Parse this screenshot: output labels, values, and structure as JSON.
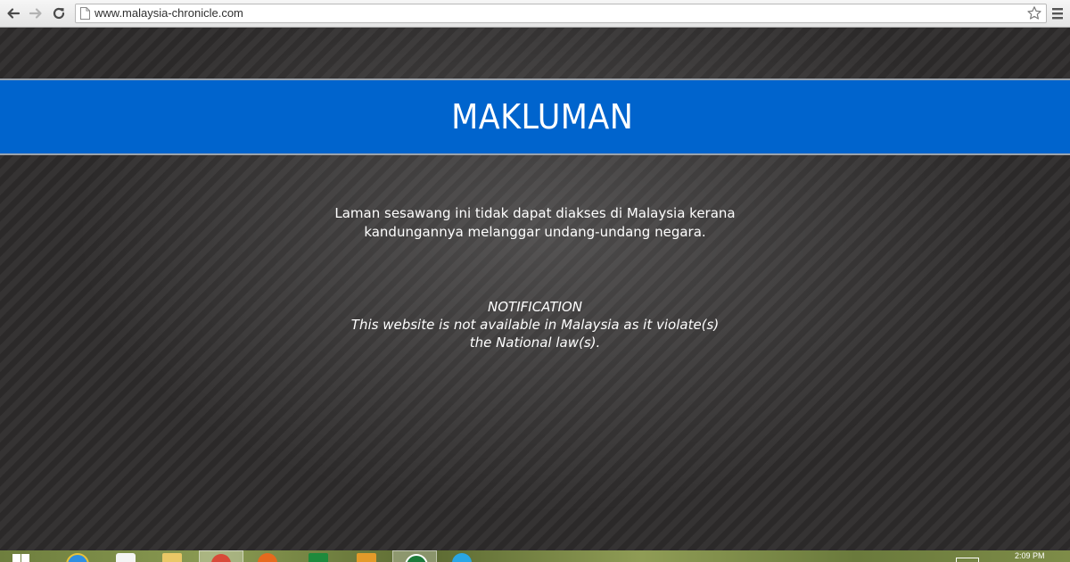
{
  "browser": {
    "url": "www.malaysia-chronicle.com",
    "icons": {
      "back": "back-arrow-icon",
      "forward": "forward-arrow-icon",
      "reload": "reload-icon",
      "page": "page-icon",
      "bookmark": "star-icon",
      "menu": "hamburger-menu-icon"
    }
  },
  "notice": {
    "title": "MAKLUMAN",
    "malay_line1": "Laman sesawang ini tidak dapat diakses di Malaysia kerana",
    "malay_line2": "kandungannya melanggar undang-undang negara.",
    "english_heading": "NOTIFICATION",
    "english_line1": "This website is not available in Malaysia as it violate(s)",
    "english_line2": "the National law(s)."
  },
  "taskbar": {
    "clock": "2:09 PM",
    "apps": [
      "windows-start-icon",
      "internet-explorer-icon",
      "store-icon",
      "file-explorer-icon",
      "chrome-icon",
      "firefox-icon",
      "excel-icon",
      "app-icon",
      "app-icon-2",
      "skype-icon"
    ]
  },
  "colors": {
    "banner": "#0064cd",
    "page_background": "#2a2828",
    "text": "#ffffff"
  }
}
